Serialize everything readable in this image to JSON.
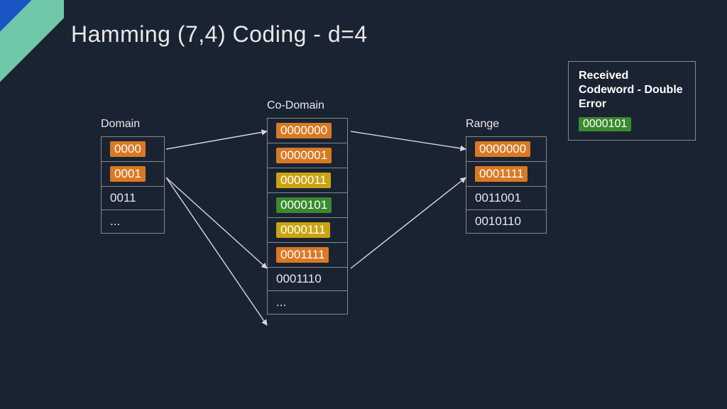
{
  "title": "Hamming (7,4) Coding - d=4",
  "domain": {
    "label": "Domain",
    "items": [
      {
        "text": "0000",
        "hl": "orange"
      },
      {
        "text": "0001",
        "hl": "orange"
      },
      {
        "text": "0011",
        "hl": null
      },
      {
        "text": "...",
        "hl": null
      }
    ]
  },
  "codomain": {
    "label": "Co-Domain",
    "items": [
      {
        "text": "0000000",
        "hl": "orange"
      },
      {
        "text": "0000001",
        "hl": "orange"
      },
      {
        "text": "0000011",
        "hl": "yellow"
      },
      {
        "text": "0000101",
        "hl": "green"
      },
      {
        "text": "0000111",
        "hl": "yellow"
      },
      {
        "text": "0001111",
        "hl": "orange"
      },
      {
        "text": "0001110",
        "hl": null
      },
      {
        "text": "...",
        "hl": null
      }
    ]
  },
  "range": {
    "label": "Range",
    "items": [
      {
        "text": "0000000",
        "hl": "orange"
      },
      {
        "text": "0001111",
        "hl": "orange"
      },
      {
        "text": "0011001",
        "hl": null
      },
      {
        "text": "0010110",
        "hl": null
      }
    ]
  },
  "received": {
    "title": "Received Codeword - Double Error",
    "value": "0000101",
    "hl": "green"
  }
}
